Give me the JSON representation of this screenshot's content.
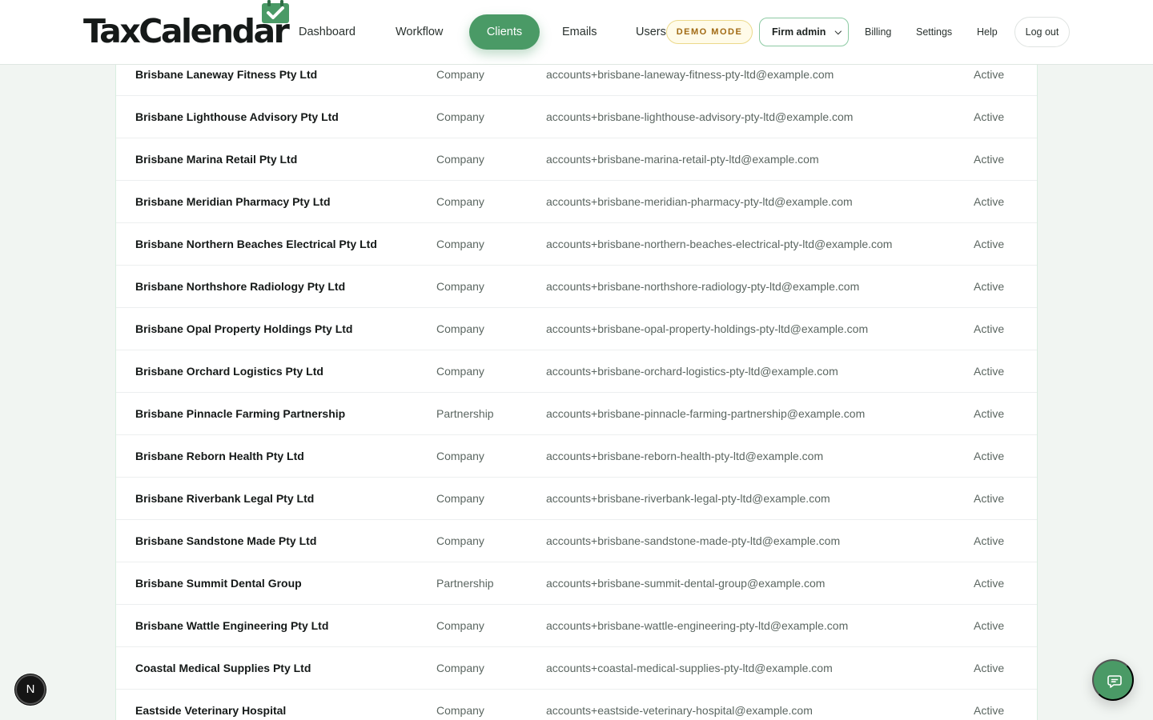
{
  "brand": {
    "name": "TaxCalendar",
    "accent": "#4a9a66"
  },
  "nav": {
    "items": [
      {
        "label": "Dashboard"
      },
      {
        "label": "Workflow"
      },
      {
        "label": "Clients"
      },
      {
        "label": "Emails"
      },
      {
        "label": "Users"
      }
    ],
    "active": "Clients"
  },
  "header": {
    "demo_badge": "DEMO MODE",
    "role_select": {
      "value": "Firm admin",
      "icon": "chevron-down-icon"
    },
    "links": [
      {
        "label": "Billing"
      },
      {
        "label": "Settings"
      },
      {
        "label": "Help"
      }
    ],
    "logout_label": "Log out"
  },
  "clients": [
    {
      "name": "Brisbane Laneway Fitness Pty Ltd",
      "type": "Company",
      "email": "accounts+brisbane-laneway-fitness-pty-ltd@example.com",
      "status": "Active"
    },
    {
      "name": "Brisbane Lighthouse Advisory Pty Ltd",
      "type": "Company",
      "email": "accounts+brisbane-lighthouse-advisory-pty-ltd@example.com",
      "status": "Active"
    },
    {
      "name": "Brisbane Marina Retail Pty Ltd",
      "type": "Company",
      "email": "accounts+brisbane-marina-retail-pty-ltd@example.com",
      "status": "Active"
    },
    {
      "name": "Brisbane Meridian Pharmacy Pty Ltd",
      "type": "Company",
      "email": "accounts+brisbane-meridian-pharmacy-pty-ltd@example.com",
      "status": "Active"
    },
    {
      "name": "Brisbane Northern Beaches Electrical Pty Ltd",
      "type": "Company",
      "email": "accounts+brisbane-northern-beaches-electrical-pty-ltd@example.com",
      "status": "Active"
    },
    {
      "name": "Brisbane Northshore Radiology Pty Ltd",
      "type": "Company",
      "email": "accounts+brisbane-northshore-radiology-pty-ltd@example.com",
      "status": "Active"
    },
    {
      "name": "Brisbane Opal Property Holdings Pty Ltd",
      "type": "Company",
      "email": "accounts+brisbane-opal-property-holdings-pty-ltd@example.com",
      "status": "Active"
    },
    {
      "name": "Brisbane Orchard Logistics Pty Ltd",
      "type": "Company",
      "email": "accounts+brisbane-orchard-logistics-pty-ltd@example.com",
      "status": "Active"
    },
    {
      "name": "Brisbane Pinnacle Farming Partnership",
      "type": "Partnership",
      "email": "accounts+brisbane-pinnacle-farming-partnership@example.com",
      "status": "Active"
    },
    {
      "name": "Brisbane Reborn Health Pty Ltd",
      "type": "Company",
      "email": "accounts+brisbane-reborn-health-pty-ltd@example.com",
      "status": "Active"
    },
    {
      "name": "Brisbane Riverbank Legal Pty Ltd",
      "type": "Company",
      "email": "accounts+brisbane-riverbank-legal-pty-ltd@example.com",
      "status": "Active"
    },
    {
      "name": "Brisbane Sandstone Made Pty Ltd",
      "type": "Company",
      "email": "accounts+brisbane-sandstone-made-pty-ltd@example.com",
      "status": "Active"
    },
    {
      "name": "Brisbane Summit Dental Group",
      "type": "Partnership",
      "email": "accounts+brisbane-summit-dental-group@example.com",
      "status": "Active"
    },
    {
      "name": "Brisbane Wattle Engineering Pty Ltd",
      "type": "Company",
      "email": "accounts+brisbane-wattle-engineering-pty-ltd@example.com",
      "status": "Active"
    },
    {
      "name": "Coastal Medical Supplies Pty Ltd",
      "type": "Company",
      "email": "accounts+coastal-medical-supplies-pty-ltd@example.com",
      "status": "Active"
    },
    {
      "name": "Eastside Veterinary Hospital",
      "type": "Company",
      "email": "accounts+eastside-veterinary-hospital@example.com",
      "status": "Active"
    }
  ],
  "floating": {
    "dev_button": {
      "label": "N",
      "icon": "next-logo-icon"
    },
    "chat_button": {
      "icon": "chat-bubble-icon"
    }
  }
}
